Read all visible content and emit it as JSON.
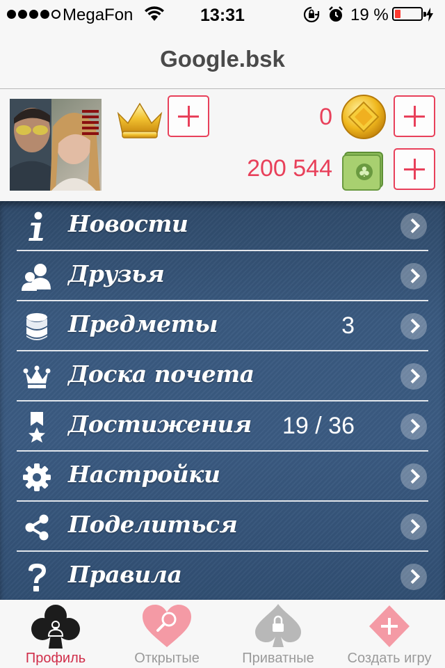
{
  "status_bar": {
    "carrier": "MegaFon",
    "time": "13:31",
    "battery_percent": "19 %",
    "battery_level": 0.19,
    "signal_bars_filled": 4,
    "signal_bars_total": 5
  },
  "nav": {
    "title": "Google.bsk"
  },
  "profile": {
    "coins": "0",
    "money": "200 544"
  },
  "menu": {
    "items": [
      {
        "label": "Новости",
        "count": "",
        "icon": "info-icon"
      },
      {
        "label": "Друзья",
        "count": "",
        "icon": "friends-icon"
      },
      {
        "label": "Предметы",
        "count": "3",
        "icon": "coins-stack-icon"
      },
      {
        "label": "Доска почета",
        "count": "",
        "icon": "crown-icon"
      },
      {
        "label": "Достижения",
        "count": "19 / 36",
        "icon": "award-ribbon-icon"
      },
      {
        "label": "Настройки",
        "count": "",
        "icon": "gear-icon"
      },
      {
        "label": "Поделиться",
        "count": "",
        "icon": "share-icon"
      },
      {
        "label": "Правила",
        "count": "",
        "icon": "question-icon"
      }
    ]
  },
  "tabbar": {
    "tabs": [
      {
        "label": "Профиль",
        "icon": "club-user-icon",
        "active": true
      },
      {
        "label": "Открытые",
        "icon": "heart-search-icon",
        "active": false
      },
      {
        "label": "Приватные",
        "icon": "spade-lock-icon",
        "active": false
      },
      {
        "label": "Создать игру",
        "icon": "diamond-plus-icon",
        "active": false
      }
    ]
  },
  "colors": {
    "accent": "#e8405a",
    "menu_background": "#3a5a80",
    "active_tab": "#d02e4a"
  }
}
